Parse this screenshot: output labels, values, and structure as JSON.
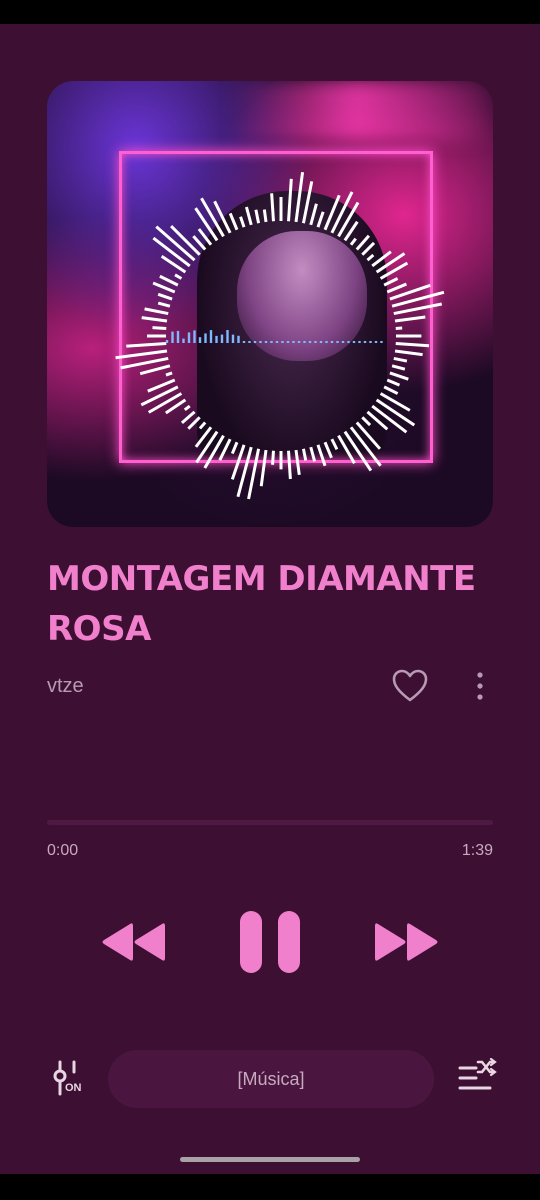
{
  "track": {
    "title": "MONTAGEM DIAMANTE ROSA",
    "artist": "vtze"
  },
  "playback": {
    "elapsed": "0:00",
    "total": "1:39",
    "progress_fraction": 0.0,
    "state": "playing"
  },
  "icons": {
    "favorite": "heart-outline-icon",
    "more": "more-vertical-icon",
    "previous": "rewind-icon",
    "play_pause": "pause-icon",
    "next": "fast-forward-icon",
    "equalizer": "equalizer-icon",
    "queue": "queue-shuffle-icon"
  },
  "equalizer": {
    "state_label": "ON"
  },
  "lyrics": {
    "label": "[Música]"
  },
  "colors": {
    "background": "#3d0f33",
    "accent": "#f080cc",
    "secondary_text": "#b89ab2",
    "pill": "#4a1640"
  }
}
